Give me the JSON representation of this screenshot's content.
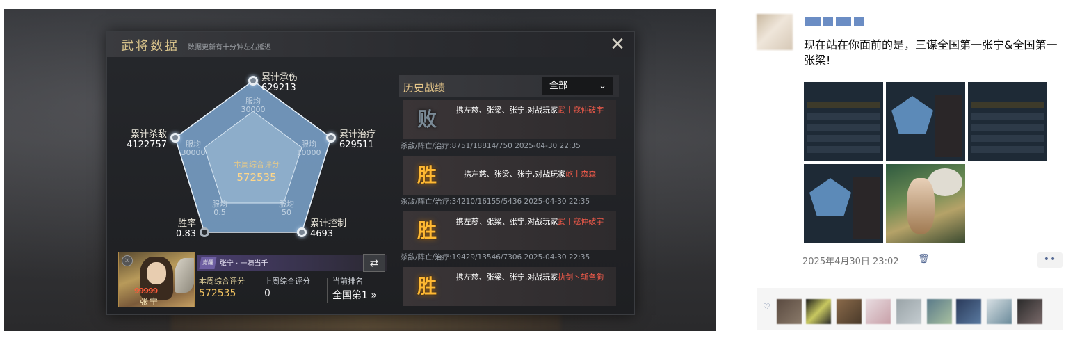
{
  "game": {
    "panel_title": "武将数据",
    "panel_subtitle": "数据更新有十分钟左右延迟",
    "close_glyph": "✕",
    "radar": {
      "stats": {
        "damage_taken": {
          "label": "累计承伤",
          "value": "629213"
        },
        "kills": {
          "label": "累计杀敌",
          "value": "4122757"
        },
        "healing": {
          "label": "累计治疗",
          "value": "629511"
        },
        "win_rate": {
          "label": "胜率",
          "value": "0.83"
        },
        "control": {
          "label": "累计控制",
          "value": "4693"
        }
      },
      "server_avg": {
        "top": {
          "label": "服均",
          "value": "30000"
        },
        "left": {
          "label": "服均",
          "value": "30000"
        },
        "right": {
          "label": "服均",
          "value": "10000"
        },
        "bottom_left": {
          "label": "服均",
          "value": "0.5"
        },
        "bottom_right": {
          "label": "服均",
          "value": "50"
        }
      },
      "center": {
        "label": "本周综合评分",
        "value": "572535"
      }
    },
    "hero": {
      "name": "张宁",
      "badges": "99999",
      "title_icon": "觉醒",
      "title": "张宁 · 一骑当千",
      "this_week_label": "本周综合评分",
      "this_week_value": "572535",
      "last_week_label": "上周综合评分",
      "last_week_value": "0",
      "rank_label": "当前排名",
      "rank_value": "全国第1 »"
    },
    "history": {
      "title": "历史战绩",
      "filter": "全部",
      "records": [
        {
          "result": "败",
          "outcome": "lose",
          "desc": "携左慈、张梁、张宁,对战玩家",
          "opponent": "武丨寇仲破宇",
          "meta": "杀敌/阵亡/治疗:8751/18814/750    2025-04-30 22:35"
        },
        {
          "result": "胜",
          "outcome": "win",
          "desc": "携左慈、张梁、张宁,对战玩家",
          "opponent": "屹丨森森",
          "meta": "杀敌/阵亡/治疗:34210/16155/5436 2025-04-30 22:35"
        },
        {
          "result": "胜",
          "outcome": "win",
          "desc": "携左慈、张梁、张宁,对战玩家",
          "opponent": "武丨寇仲破宇",
          "meta": "杀敌/阵亡/治疗:19429/13546/7306 2025-04-30 22:35"
        },
        {
          "result": "胜",
          "outcome": "win",
          "desc": "携左慈、张梁、张宁,对战玩家",
          "opponent": "执剑丶斩刍狗",
          "meta": ""
        }
      ]
    }
  },
  "wechat": {
    "post_text": "现在站在你面前的是，三谋全国第一张宁&全国第一张梁!",
    "post_time": "2025年4月30日 23:02",
    "more_glyph": "••",
    "colors": {
      "link": "#576b95",
      "text": "#111111",
      "time": "#737373"
    }
  }
}
